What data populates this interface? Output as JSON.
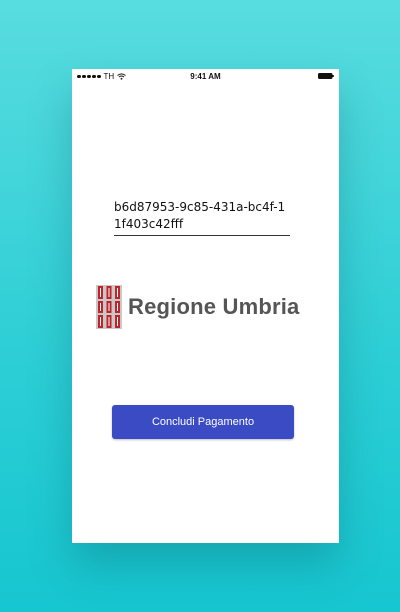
{
  "status_bar": {
    "carrier": "TH",
    "time": "9:41 AM",
    "icons": [
      "signal-dots-icon",
      "wifi-icon",
      "battery-icon"
    ]
  },
  "token": {
    "value": "b6d87953-9c85-431a-bc4f-11f403c42fff"
  },
  "logo": {
    "text": "Regione Umbria",
    "accent": "#c0242b"
  },
  "actions": {
    "pay_label": "Concludi Pagamento",
    "pay_color": "#3a4bc4"
  }
}
